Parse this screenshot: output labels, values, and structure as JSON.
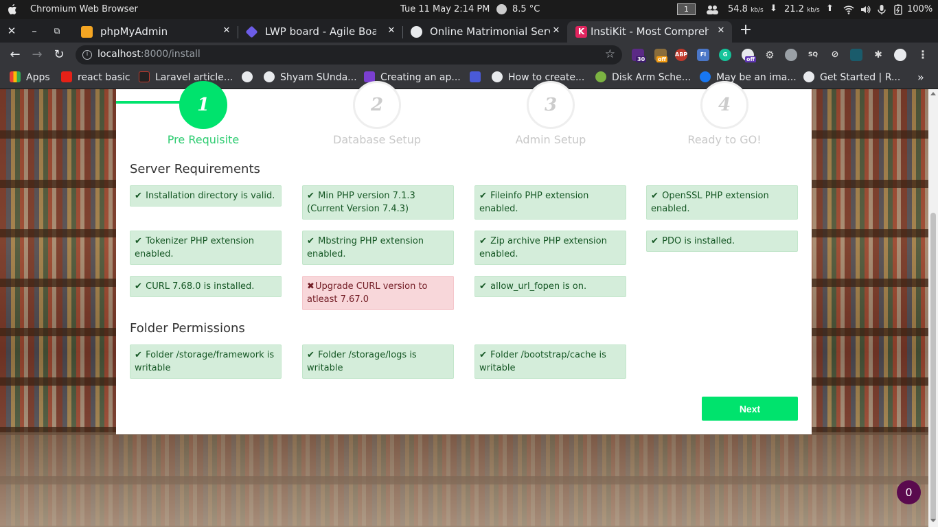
{
  "os": {
    "app_name": "Chromium Web Browser",
    "clock": "Tue 11 May   2:14 PM",
    "temperature": "8.5 °C",
    "workspace": "1",
    "net_down": "54.8",
    "net_down_unit": "kb/s",
    "net_up": "21.2",
    "net_up_unit": "kb/s",
    "battery": "100%"
  },
  "tabs": [
    {
      "title": "phpMyAdmin",
      "favicon_color": "#f5a623"
    },
    {
      "title": "LWP board - Agile Board -",
      "favicon_color": "#6c5ce7"
    },
    {
      "title": "Online Matrimonial Servic",
      "favicon_color": "#e8eaed"
    },
    {
      "title": "InstiKit - Most Comprehen",
      "favicon_color": "#e0245e"
    }
  ],
  "toolbar": {
    "url_host": "localhost",
    "url_rest": ":8000/install"
  },
  "extensions": {
    "badge_30": "30",
    "badge_off": "off",
    "abp": "ABP",
    "fi": "FI",
    "badge_off2": "off"
  },
  "bookmarks": [
    {
      "label": "Apps"
    },
    {
      "label": "react basic"
    },
    {
      "label": "Laravel article..."
    },
    {
      "label": ""
    },
    {
      "label": "Shyam SUnda..."
    },
    {
      "label": "Creating an ap..."
    },
    {
      "label": ""
    },
    {
      "label": "How to create..."
    },
    {
      "label": "Disk Arm Sche..."
    },
    {
      "label": "May be an ima..."
    },
    {
      "label": "Get Started | R..."
    }
  ],
  "install": {
    "steps": [
      {
        "number": "1",
        "label": "Pre Requisite"
      },
      {
        "number": "2",
        "label": "Database Setup"
      },
      {
        "number": "3",
        "label": "Admin Setup"
      },
      {
        "number": "4",
        "label": "Ready to GO!"
      }
    ],
    "server_heading": "Server Requirements",
    "server_requirements": [
      {
        "text": "Installation directory is valid.",
        "ok": true
      },
      {
        "text": "Min PHP version 7.1.3 (Current Version 7.4.3)",
        "ok": true
      },
      {
        "text": "Fileinfo PHP extension enabled.",
        "ok": true
      },
      {
        "text": "OpenSSL PHP extension enabled.",
        "ok": true
      },
      {
        "text": "Tokenizer PHP extension enabled.",
        "ok": true
      },
      {
        "text": "Mbstring PHP extension enabled.",
        "ok": true
      },
      {
        "text": "Zip archive PHP extension enabled.",
        "ok": true
      },
      {
        "text": "PDO is installed.",
        "ok": true
      },
      {
        "text": "CURL 7.68.0 is installed.",
        "ok": true
      },
      {
        "text": "Upgrade CURL version to atleast 7.67.0",
        "ok": false
      },
      {
        "text": "allow_url_fopen is on.",
        "ok": true
      }
    ],
    "folder_heading": "Folder Permissions",
    "folder_permissions": [
      {
        "text": "Folder /storage/framework is writable",
        "ok": true
      },
      {
        "text": "Folder /storage/logs is writable",
        "ok": true
      },
      {
        "text": "Folder /bootstrap/cache is writable",
        "ok": true
      }
    ],
    "check_mark": "✔",
    "cross_mark": "✖",
    "next_label": "Next"
  },
  "chat_badge": "0"
}
